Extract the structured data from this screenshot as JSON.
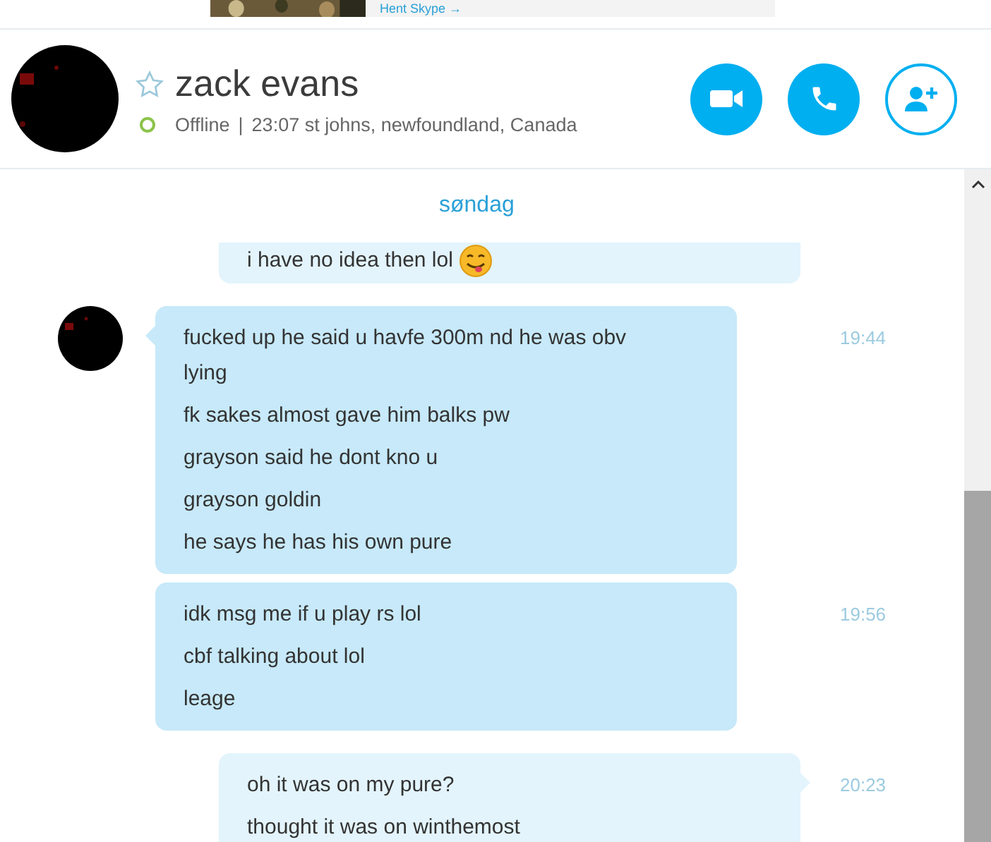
{
  "banner": {
    "link": "Hent Skype",
    "link_arrow": "→"
  },
  "contact": {
    "name": "zack evans",
    "favorite": false,
    "online": false,
    "status": "Offline",
    "separator": "|",
    "status_info": "23:07 st johns, newfoundland, Canada"
  },
  "conversation": {
    "date": "søndag",
    "messages": [
      {
        "kind": "outgoing",
        "cut_top": true,
        "avatar": false,
        "lines": [
          "i have no idea then lol"
        ],
        "emoji": true
      },
      {
        "kind": "incoming",
        "cut_top": false,
        "avatar": true,
        "time": "19:44",
        "lines": [
          "fucked up he said u havfe 300m nd he was obv lying",
          "fk sakes almost gave him balks pw",
          "grayson said he dont kno u",
          "grayson goldin",
          "he says he has his own pure"
        ],
        "emoji": false
      },
      {
        "kind": "incoming",
        "cut_top": false,
        "avatar": false,
        "time": "19:56",
        "lines": [
          "idk msg me if u play rs lol",
          "cbf talking about lol",
          "leage"
        ],
        "emoji": false
      },
      {
        "kind": "outgoing",
        "cut_top": false,
        "avatar": false,
        "time": "20:23",
        "lines": [
          "oh it was on my pure?",
          "thought it was on winthemost"
        ],
        "emoji": false
      }
    ]
  }
}
